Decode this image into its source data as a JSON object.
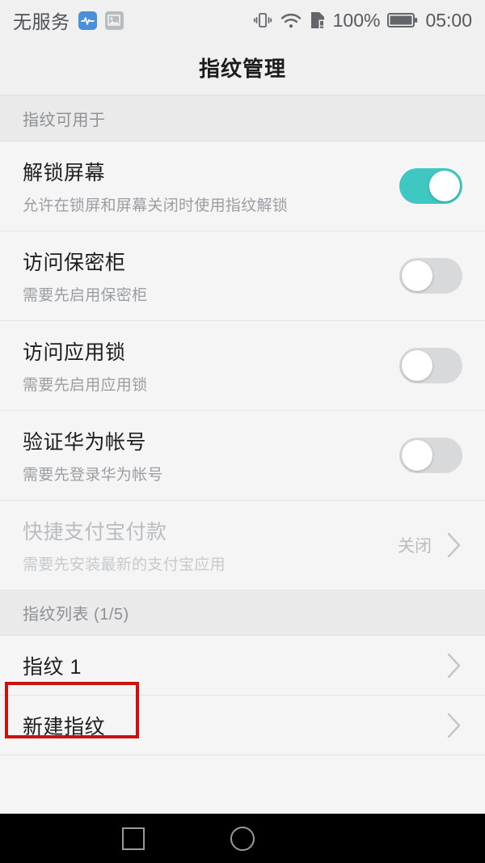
{
  "status_bar": {
    "carrier": "无服务",
    "battery_percent": "100%",
    "clock": "05:00",
    "icons": [
      "health-icon",
      "screenshot-icon",
      "vibrate-icon",
      "wifi-icon",
      "sim-card-icon",
      "battery-icon"
    ]
  },
  "header": {
    "title": "指纹管理"
  },
  "sections": [
    {
      "header": "指纹可用于",
      "rows": [
        {
          "title": "解锁屏幕",
          "subtitle": "允许在锁屏和屏幕关闭时使用指纹解锁",
          "control": "toggle",
          "toggle_on": true,
          "disabled": false
        },
        {
          "title": "访问保密柜",
          "subtitle": "需要先启用保密柜",
          "control": "toggle",
          "toggle_on": false,
          "disabled": false
        },
        {
          "title": "访问应用锁",
          "subtitle": "需要先启用应用锁",
          "control": "toggle",
          "toggle_on": false,
          "disabled": false
        },
        {
          "title": "验证华为帐号",
          "subtitle": "需要先登录华为帐号",
          "control": "toggle",
          "toggle_on": false,
          "disabled": false
        },
        {
          "title": "快捷支付宝付款",
          "subtitle": "需要先安装最新的支付宝应用",
          "control": "value-chevron",
          "value": "关闭",
          "disabled": true
        }
      ]
    },
    {
      "header": "指纹列表 (1/5)",
      "rows": [
        {
          "title": "指纹 1",
          "subtitle": "",
          "control": "chevron",
          "disabled": false
        },
        {
          "title": "新建指纹",
          "subtitle": "",
          "control": "chevron",
          "disabled": false,
          "highlighted": true
        }
      ]
    }
  ],
  "nav_bar": {
    "recents_label": "recents-square-icon",
    "home_label": "home-circle-icon"
  },
  "colors": {
    "toggle_on": "#3fc7c2",
    "toggle_off": "#d8d9da",
    "highlight_box": "#cc1111",
    "page_bg": "#f5f5f5",
    "header_bg": "#f0f0f0",
    "section_bg": "#eaeaea"
  }
}
